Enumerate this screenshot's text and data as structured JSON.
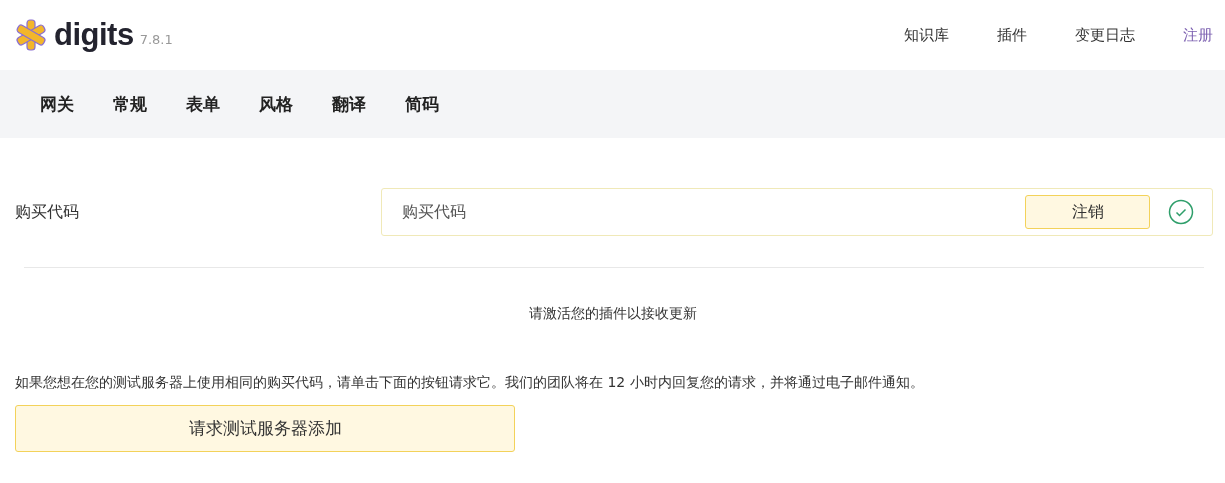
{
  "header": {
    "brand": "digits",
    "version": "7.8.1",
    "links": [
      {
        "label": "知识库",
        "kind": "plain"
      },
      {
        "label": "插件",
        "kind": "plain"
      },
      {
        "label": "变更日志",
        "kind": "plain"
      },
      {
        "label": "注册",
        "kind": "accent"
      }
    ]
  },
  "tabs": [
    {
      "label": "网关"
    },
    {
      "label": "常规"
    },
    {
      "label": "表单"
    },
    {
      "label": "风格"
    },
    {
      "label": "翻译"
    },
    {
      "label": "简码"
    }
  ],
  "purchase": {
    "label": "购买代码",
    "value": "购买代码",
    "button": "注销",
    "verified": true
  },
  "notice": "请激活您的插件以接收更新",
  "info": "如果您想在您的测试服务器上使用相同的购买代码，请单击下面的按钮请求它。我们的团队将在 12 小时内回复您的请求，并将通过电子邮件通知。",
  "request_button": "请求测试服务器添加"
}
